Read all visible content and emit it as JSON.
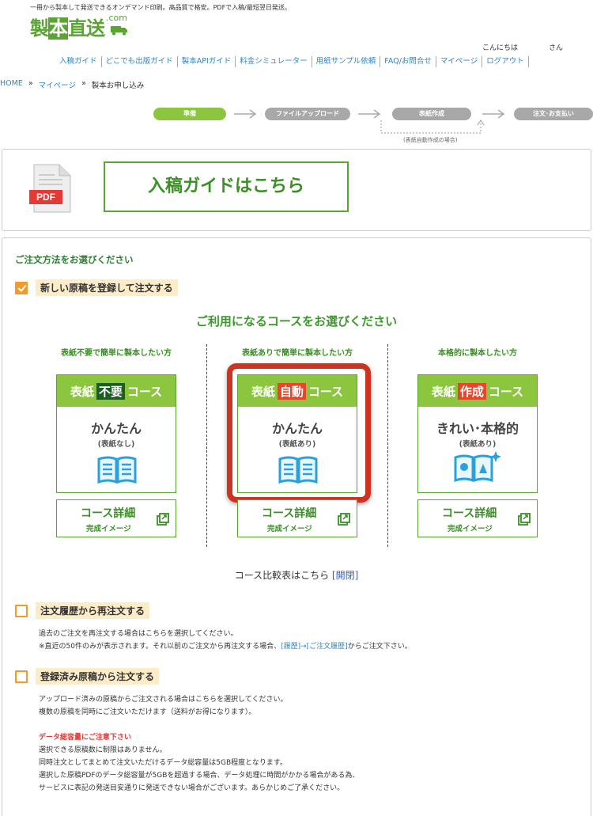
{
  "header": {
    "tagline": "一冊から製本して発送できるオンデマンド印刷。高品質で格安。PDFで入稿/最短翌日発送。",
    "logo_pre": "製",
    "logo_boxed": "本",
    "logo_post": "直送",
    "logo_com": ".com",
    "greeting": "こんにちは",
    "greeting_suffix": "さん"
  },
  "nav": {
    "items": [
      "入稿ガイド",
      "どこでも出版ガイド",
      "製本APIガイド",
      "料金シミュレーター",
      "用紙サンプル依頼",
      "FAQ/お問合せ",
      "マイページ",
      "ログアウト"
    ]
  },
  "breadcrumb": {
    "home": "HOME",
    "sep": "»",
    "mypage": "マイページ",
    "current": "製本お申し込み"
  },
  "steps": {
    "items": [
      "準備",
      "ファイルアップロード",
      "表紙作成",
      "注文･お支払い"
    ],
    "note": "(表紙自動作成の場合)"
  },
  "guide": {
    "pdf_label": "PDF",
    "button": "入稿ガイドはこちら"
  },
  "order": {
    "heading": "ご注文方法をお選びください",
    "option_new": "新しい原稿を登録して注文する",
    "select_course": "ご利用になるコースをお選びください",
    "columns": [
      {
        "title": "表紙不要で簡単に製本したい方",
        "head_pre": "表紙",
        "head_em": "不要",
        "head_post": "コース",
        "main": "かんたん",
        "sub": "(表紙なし)",
        "detail": "コース詳細",
        "detail_sub": "完成イメージ"
      },
      {
        "title": "表紙ありで簡単に製本したい方",
        "head_pre": "表紙",
        "head_em": "自動",
        "head_post": "コース",
        "main": "かんたん",
        "sub": "(表紙あり)",
        "detail": "コース詳細",
        "detail_sub": "完成イメージ"
      },
      {
        "title": "本格的に製本したい方",
        "head_pre": "表紙",
        "head_em": "作成",
        "head_post": "コース",
        "main": "きれい･本格的",
        "sub": "(表紙あり)",
        "detail": "コース詳細",
        "detail_sub": "完成イメージ"
      }
    ],
    "compare": "コース比較表はこちら",
    "compare_link": "[開閉]",
    "option_reorder": "注文履歴から再注文する",
    "reorder_desc1": "過去のご注文を再注文する場合はこちらを選択してください。",
    "reorder_desc2_pre": "※直近の50件のみが表示されます。それ以前のご注文から再注文する場合、",
    "reorder_desc2_link": "[履歴]→[ご注文履歴]",
    "reorder_desc2_post": "からご注文下さい。",
    "option_registered": "登録済み原稿から注文する",
    "reg_desc1": "アップロード済みの原稿からご注文される場合はこちらを選択してください。",
    "reg_desc2": "複数の原稿を同時にご注文いただけます（送料がお得になります）。",
    "warn_title": "データ総容量にご注意下さい",
    "warn1": "選択できる原稿数に制限はありません。",
    "warn2": "同時注文としてまとめて注文いただけるデータ総容量は5GB程度となります。",
    "warn3": "選択した原稿PDFのデータ総容量が5GBを超過する場合、データ処理に時間がかかる場合がある為、",
    "warn4": "サービスに表記の発送目安通りに発送できない場合がございます。あらかじめご了承ください。"
  },
  "colors": {
    "brand_green": "#5aa431",
    "light_green": "#8cc63f",
    "accent_orange": "#f39a2b",
    "accent_red": "#cc3320",
    "link_blue": "#2c86c9"
  }
}
